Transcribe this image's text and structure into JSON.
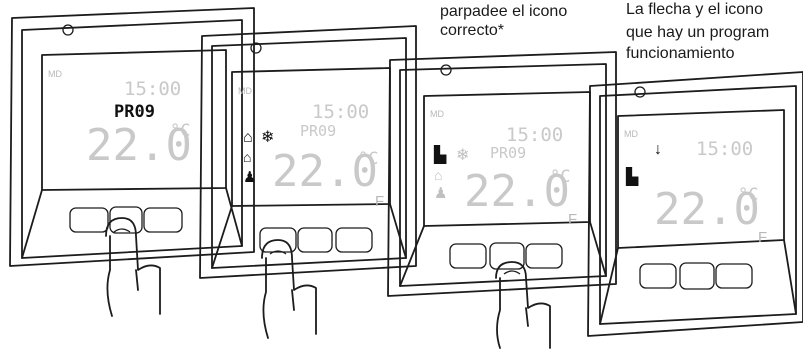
{
  "captions": {
    "left_line1": "parpadee el icono",
    "left_line2": "correcto*",
    "right_line1": "La flecha y el icono",
    "right_line2": "que hay un program",
    "right_line3": "funcionamiento"
  },
  "devices": [
    {
      "time": "15:00",
      "prog": "PR09",
      "temp": "22.0",
      "unit": "°C",
      "md": "MD"
    },
    {
      "time": "15:00",
      "prog": "PR09",
      "temp": "22.0",
      "unit": "°C",
      "md": "MD",
      "mode": "F"
    },
    {
      "time": "15:00",
      "prog": "PR09",
      "temp": "22.0",
      "unit": "°C",
      "md": "MD",
      "mode": "F"
    },
    {
      "time": "15:00",
      "temp": "22.0",
      "unit": "°C",
      "md": "MD",
      "mode": "F"
    }
  ],
  "colors": {
    "pressed_button": "#c8c8c8",
    "lcd_segment_dim": "#c9c9c9",
    "outline": "#1c1c1c"
  },
  "icons": [
    "house-icon",
    "snowflake-icon",
    "home-person-icon",
    "person-icon",
    "arrow-down-icon",
    "finger-press-icon"
  ]
}
